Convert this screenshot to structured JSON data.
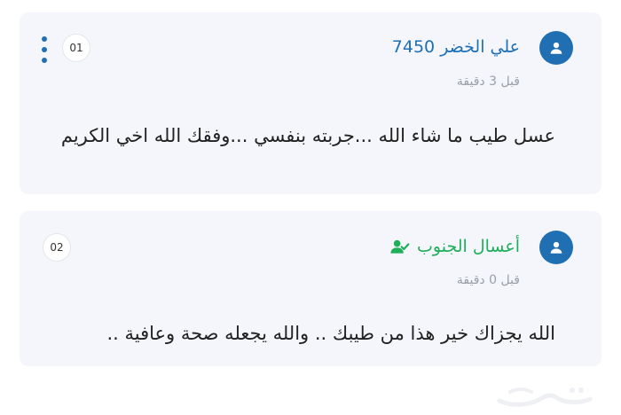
{
  "comments": [
    {
      "user": "علي الخضر 7450",
      "time": "قبل 3 دقيقة",
      "text": "عسل طيب ما شاء الله ...جربته بنفسي ...وفقك الله اخي الكريم",
      "badge": "01",
      "name_color": "#1d6fb8"
    },
    {
      "user": "أعسال الجنوب",
      "time": "قبل 0 دقيقة",
      "text": "الله يجزاك خير هذا من طيبك .. والله يجعله صحة وعافية ..",
      "badge": "02",
      "name_color": "#1fae5a",
      "verified_icon": "user-check-icon"
    }
  ],
  "colors": {
    "card_bg": "#f4f6fb",
    "avatar": "#1f6fb2",
    "muted": "#9a9ea6"
  },
  "icons": [
    "user-icon",
    "more-vertical-icon",
    "user-check-icon",
    "haraj-logo"
  ]
}
